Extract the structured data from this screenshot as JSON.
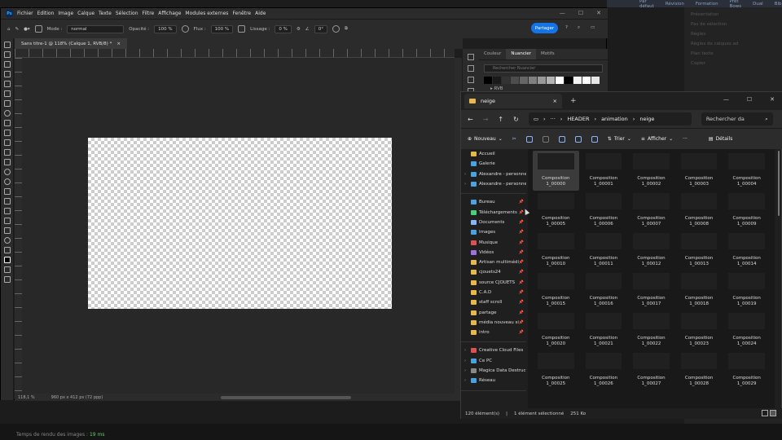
{
  "background_app": {
    "top_tabs": [
      "Par défaut",
      "Révision",
      "Formation",
      "Prêt Bows",
      "Dual",
      "Bibliothèques"
    ],
    "right_panel_lines": [
      "Présentation",
      "Pas de sélection",
      "",
      "Règles",
      "Règles de calques ad",
      "Plan texte",
      "Copier"
    ],
    "render_label": "Temps de rendu des images :",
    "render_value": "19 ms"
  },
  "photoshop": {
    "logo": "Ps",
    "menu": [
      "Fichier",
      "Edition",
      "Image",
      "Calque",
      "Texte",
      "Sélection",
      "Filtre",
      "Affichage",
      "Modules externes",
      "Fenêtre",
      "Aide"
    ],
    "options": {
      "mode_label": "Mode :",
      "mode_value": "normal",
      "opacity_label": "Opacité :",
      "opacity_value": "100 %",
      "flow_label": "Flux :",
      "flow_value": "100 %",
      "smoothing_label": "Lissage :",
      "smoothing_value": "0 %",
      "angle_value": "0°",
      "share_label": "Partager"
    },
    "doc_tab": "Sans titre-1 @ 118% (Calque 1, RVB/8) *",
    "doc_tab_close": "×",
    "status": {
      "zoom": "118,1 %",
      "size": "960 px x 412 px (72 ppp)"
    },
    "panel": {
      "tabs": [
        "Couleur",
        "Nuancier",
        "Motifs"
      ],
      "active_tab": "Nuancier",
      "search_placeholder": "Rechercher Nuancier",
      "group_label": "RVB",
      "swatch_colors": [
        "#000000",
        "#1a1a1a",
        "#333333",
        "#4d4d4d",
        "#666666",
        "#808080",
        "#999999",
        "#b3b3b3",
        "#ffffff",
        "#000000",
        "#f2f2f2",
        "#ffffff",
        "#e6e6e6"
      ]
    }
  },
  "explorer": {
    "tab_title": "neige",
    "tab_close": "×",
    "new_tab": "+",
    "window_buttons": [
      "—",
      "☐",
      "✕"
    ],
    "nav_back": "←",
    "nav_forward": "→",
    "nav_up": "↑",
    "nav_refresh": "↻",
    "breadcrumb": [
      "HEADER",
      "animation",
      "neige"
    ],
    "breadcrumb_more": "···",
    "search_placeholder": "Rechercher da",
    "commands": {
      "new_label": "Nouveau",
      "sort_label": "Trier",
      "view_label": "Afficher",
      "more_label": "···",
      "details_label": "Détails"
    },
    "nav_items_top": [
      {
        "label": "Accueil",
        "color": "#e8b84a"
      },
      {
        "label": "Galerie",
        "color": "#4aa3df"
      },
      {
        "label": "Alexandre - personne",
        "color": "#4aa3df"
      },
      {
        "label": "Alexandre - personne",
        "color": "#4aa3df"
      }
    ],
    "nav_items_pinned": [
      {
        "label": "Bureau",
        "color": "#4aa3df"
      },
      {
        "label": "Téléchargements",
        "color": "#4ad07a"
      },
      {
        "label": "Documents",
        "color": "#8ab4f8"
      },
      {
        "label": "Images",
        "color": "#4aa3df"
      },
      {
        "label": "Musique",
        "color": "#e05050"
      },
      {
        "label": "Vidéos",
        "color": "#a070e0"
      },
      {
        "label": "Artisan multimédi",
        "color": "#e8b84a"
      },
      {
        "label": "cjouets24",
        "color": "#e8b84a"
      },
      {
        "label": "source CJOUETS",
        "color": "#e8b84a"
      },
      {
        "label": "C.A.D",
        "color": "#e8b84a"
      },
      {
        "label": "staff scroll",
        "color": "#e8b84a"
      },
      {
        "label": "partage",
        "color": "#e8b84a"
      },
      {
        "label": "média nouveau si",
        "color": "#e8b84a"
      },
      {
        "label": "intro",
        "color": "#e8b84a"
      }
    ],
    "nav_items_bottom": [
      {
        "label": "Creative Cloud Files",
        "color": "#e05050"
      },
      {
        "label": "Ce PC",
        "color": "#4aa3df"
      },
      {
        "label": "Magica Data Destruc",
        "color": "#888888"
      },
      {
        "label": "Réseau",
        "color": "#4aa3df"
      }
    ],
    "files": [
      "Composition 1_00000",
      "Composition 1_00001",
      "Composition 1_00002",
      "Composition 1_00003",
      "Composition 1_00004",
      "Composition 1_00005",
      "Composition 1_00006",
      "Composition 1_00007",
      "Composition 1_00008",
      "Composition 1_00009",
      "Composition 1_00010",
      "Composition 1_00011",
      "Composition 1_00012",
      "Composition 1_00013",
      "Composition 1_00014",
      "Composition 1_00015",
      "Composition 1_00016",
      "Composition 1_00017",
      "Composition 1_00018",
      "Composition 1_00019",
      "Composition 1_00020",
      "Composition 1_00021",
      "Composition 1_00022",
      "Composition 1_00023",
      "Composition 1_00024",
      "Composition 1_00025",
      "Composition 1_00026",
      "Composition 1_00027",
      "Composition 1_00028",
      "Composition 1_00029"
    ],
    "selected_index": 0,
    "status": {
      "count": "120 élément(s)",
      "selection": "1 élément sélectionné",
      "size": "251 Ko"
    }
  }
}
